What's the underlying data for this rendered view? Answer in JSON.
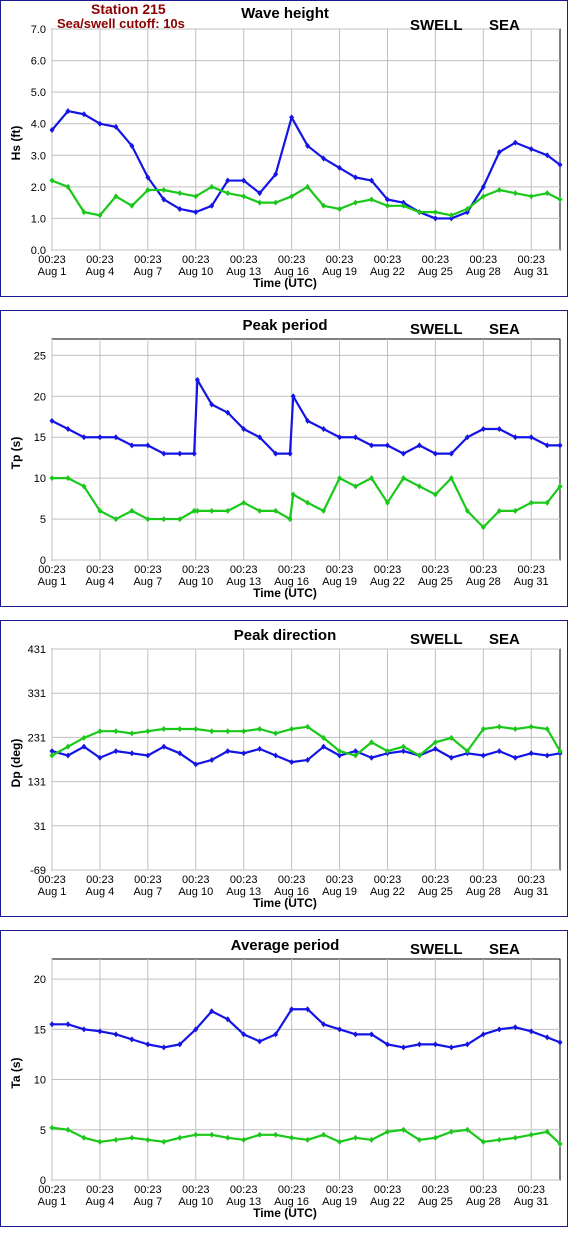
{
  "header": {
    "station": "Station 215",
    "cutoff": "Sea/swell cutoff: 10s"
  },
  "colors": {
    "swell": "#1414e6",
    "sea": "#19c819",
    "border": "#1a1a8c",
    "grid": "#c0c0c0",
    "header": "#8b0000"
  },
  "legend": {
    "swell": "SWELL",
    "sea": "SEA"
  },
  "xaxis": {
    "label": "Time (UTC)",
    "range_days": [
      0.0,
      31.8
    ],
    "ticks": [
      {
        "t": 0,
        "time": "00:23",
        "date": "Aug 1"
      },
      {
        "t": 3,
        "time": "00:23",
        "date": "Aug 4"
      },
      {
        "t": 6,
        "time": "00:23",
        "date": "Aug 7"
      },
      {
        "t": 9,
        "time": "00:23",
        "date": "Aug 10"
      },
      {
        "t": 12,
        "time": "00:23",
        "date": "Aug 13"
      },
      {
        "t": 15,
        "time": "00:23",
        "date": "Aug 16"
      },
      {
        "t": 18,
        "time": "00:23",
        "date": "Aug 19"
      },
      {
        "t": 21,
        "time": "00:23",
        "date": "Aug 22"
      },
      {
        "t": 24,
        "time": "00:23",
        "date": "Aug 25"
      },
      {
        "t": 27,
        "time": "00:23",
        "date": "Aug 28"
      },
      {
        "t": 30,
        "time": "00:23",
        "date": "Aug 31"
      }
    ]
  },
  "chart_data": [
    {
      "type": "line",
      "title": "Wave height",
      "ylabel": "Hs (ft)",
      "ylim": [
        0,
        7
      ],
      "yticks": [
        "0.0",
        "1.0",
        "2.0",
        "3.0",
        "4.0",
        "5.0",
        "6.0",
        "7.0"
      ],
      "x": [
        0,
        1,
        2,
        3,
        4,
        5,
        6,
        7,
        8,
        9,
        10,
        11,
        12,
        13,
        14,
        15,
        16,
        17,
        18,
        19,
        20,
        21,
        22,
        23,
        24,
        25,
        26,
        27,
        28,
        29,
        30,
        31,
        31.8
      ],
      "series": [
        {
          "name": "SWELL",
          "values": [
            3.8,
            4.4,
            4.3,
            4.0,
            3.9,
            3.3,
            2.3,
            1.6,
            1.3,
            1.2,
            1.4,
            2.2,
            2.2,
            1.8,
            2.4,
            4.2,
            3.3,
            2.9,
            2.6,
            2.3,
            2.2,
            1.6,
            1.5,
            1.2,
            1.0,
            1.0,
            1.2,
            2.0,
            3.1,
            3.4,
            3.2,
            3.0,
            2.7
          ]
        },
        {
          "name": "SEA",
          "values": [
            2.2,
            2.0,
            1.2,
            1.1,
            1.7,
            1.4,
            1.9,
            1.9,
            1.8,
            1.7,
            2.0,
            1.8,
            1.7,
            1.5,
            1.5,
            1.7,
            2.0,
            1.4,
            1.3,
            1.5,
            1.6,
            1.4,
            1.4,
            1.2,
            1.2,
            1.1,
            1.3,
            1.7,
            1.9,
            1.8,
            1.7,
            1.8,
            1.6
          ]
        }
      ],
      "grid": true
    },
    {
      "type": "line",
      "title": "Peak period",
      "ylabel": "Tp (s)",
      "ylim": [
        0,
        27
      ],
      "yticks": [
        [
          "0",
          0
        ],
        [
          "5",
          5
        ],
        [
          "10",
          10
        ],
        [
          "15",
          15
        ],
        [
          "20",
          20
        ],
        [
          "25",
          25
        ]
      ],
      "x": [
        0,
        1,
        2,
        3,
        4,
        5,
        6,
        7,
        8,
        8.9,
        9.1,
        10,
        11,
        12,
        13,
        14,
        14.9,
        15.1,
        16,
        17,
        18,
        19,
        20,
        21,
        22,
        23,
        24,
        25,
        26,
        27,
        28,
        29,
        30,
        31,
        31.8
      ],
      "series": [
        {
          "name": "SWELL",
          "values": [
            17,
            16,
            15,
            15,
            15,
            14,
            14,
            13,
            13,
            13,
            22,
            19,
            18,
            16,
            15,
            13,
            13,
            20,
            17,
            16,
            15,
            15,
            14,
            14,
            13,
            14,
            13,
            13,
            15,
            16,
            16,
            15,
            15,
            14,
            14
          ]
        },
        {
          "name": "SEA",
          "values": [
            10,
            10,
            9,
            6,
            5,
            6,
            5,
            5,
            5,
            6,
            6,
            6,
            6,
            7,
            6,
            6,
            5,
            8,
            7,
            6,
            10,
            9,
            10,
            7,
            10,
            9,
            8,
            10,
            6,
            4,
            6,
            6,
            7,
            7,
            9
          ]
        }
      ],
      "grid": true
    },
    {
      "type": "line",
      "title": "Peak direction",
      "ylabel": "Dp (deg)",
      "ylim": [
        -69,
        431
      ],
      "yticks": [
        [
          "-69",
          -69
        ],
        [
          "31",
          31
        ],
        [
          "131",
          131
        ],
        [
          "231",
          231
        ],
        [
          "331",
          331
        ],
        [
          "431",
          431
        ]
      ],
      "x": [
        0,
        1,
        2,
        3,
        4,
        5,
        6,
        7,
        8,
        9,
        10,
        11,
        12,
        13,
        14,
        15,
        16,
        17,
        18,
        19,
        20,
        21,
        22,
        23,
        24,
        25,
        26,
        27,
        28,
        29,
        30,
        31,
        31.8
      ],
      "series": [
        {
          "name": "SWELL",
          "values": [
            200,
            190,
            210,
            185,
            200,
            195,
            190,
            210,
            195,
            170,
            180,
            200,
            195,
            205,
            190,
            175,
            180,
            210,
            190,
            200,
            185,
            195,
            200,
            190,
            205,
            185,
            195,
            190,
            200,
            185,
            195,
            190,
            195
          ]
        },
        {
          "name": "SEA",
          "values": [
            190,
            210,
            230,
            245,
            245,
            240,
            245,
            250,
            250,
            250,
            245,
            245,
            245,
            250,
            240,
            250,
            255,
            230,
            200,
            190,
            220,
            200,
            210,
            190,
            220,
            230,
            200,
            250,
            255,
            250,
            255,
            250,
            200
          ]
        }
      ],
      "grid": true
    },
    {
      "type": "line",
      "title": "Average period",
      "ylabel": "Ta (s)",
      "ylim": [
        0,
        22
      ],
      "yticks": [
        [
          "0",
          0
        ],
        [
          "5",
          5
        ],
        [
          "10",
          10
        ],
        [
          "15",
          15
        ],
        [
          "20",
          20
        ]
      ],
      "x": [
        0,
        1,
        2,
        3,
        4,
        5,
        6,
        7,
        8,
        9,
        10,
        11,
        12,
        13,
        14,
        15,
        16,
        17,
        18,
        19,
        20,
        21,
        22,
        23,
        24,
        25,
        26,
        27,
        28,
        29,
        30,
        31,
        31.8
      ],
      "series": [
        {
          "name": "SWELL",
          "values": [
            15.5,
            15.5,
            15.0,
            14.8,
            14.5,
            14.0,
            13.5,
            13.2,
            13.5,
            15.0,
            16.8,
            16.0,
            14.5,
            13.8,
            14.5,
            17.0,
            17.0,
            15.5,
            15.0,
            14.5,
            14.5,
            13.5,
            13.2,
            13.5,
            13.5,
            13.2,
            13.5,
            14.5,
            15.0,
            15.2,
            14.8,
            14.2,
            13.7
          ]
        },
        {
          "name": "SEA",
          "values": [
            5.2,
            5.0,
            4.2,
            3.8,
            4.0,
            4.2,
            4.0,
            3.8,
            4.2,
            4.5,
            4.5,
            4.2,
            4.0,
            4.5,
            4.5,
            4.2,
            4.0,
            4.5,
            3.8,
            4.2,
            4.0,
            4.8,
            5.0,
            4.0,
            4.2,
            4.8,
            5.0,
            3.8,
            4.0,
            4.2,
            4.5,
            4.8,
            3.6
          ]
        }
      ],
      "grid": true
    }
  ]
}
